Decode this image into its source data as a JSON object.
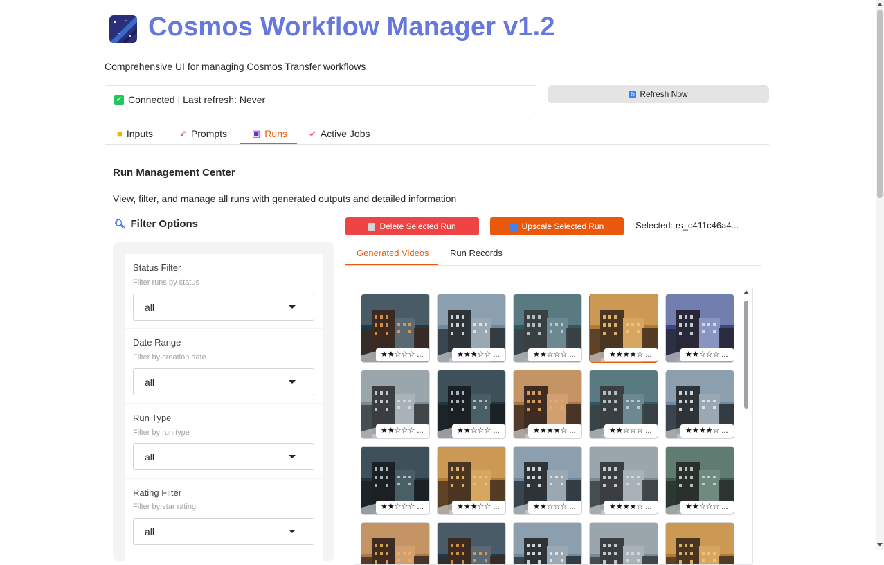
{
  "app": {
    "title": "Cosmos Workflow Manager v1.2",
    "subtitle": "Comprehensive UI for managing Cosmos Transfer workflows",
    "accent_color": "#6677dd"
  },
  "status": {
    "text": "Connected | Last refresh: Never",
    "icon": "check-icon",
    "refresh_label": "Refresh Now",
    "refresh_icon": "refresh-icon"
  },
  "tabs": [
    {
      "label": "Inputs",
      "icon": "folder-icon",
      "active": false
    },
    {
      "label": "Prompts",
      "icon": "rocket-icon",
      "active": false
    },
    {
      "label": "Runs",
      "icon": "clapper-icon",
      "active": true
    },
    {
      "label": "Active Jobs",
      "icon": "rocket-icon",
      "active": false
    }
  ],
  "runs": {
    "heading": "Run Management Center",
    "description": "View, filter, and manage all runs with generated outputs and detailed information",
    "filter_title": "Filter Options",
    "filters": [
      {
        "label": "Status Filter",
        "hint": "Filter runs by status",
        "value": "all"
      },
      {
        "label": "Date Range",
        "hint": "Filter by creation date",
        "value": "all"
      },
      {
        "label": "Run Type",
        "hint": "Filter by run type",
        "value": "all"
      },
      {
        "label": "Rating Filter",
        "hint": "Filter by star rating",
        "value": "all"
      }
    ],
    "delete_label": "Delete Selected Run",
    "upscale_label": "Upscale Selected Run",
    "selected_text": "Selected: rs_c411c46a4...",
    "subtabs": [
      {
        "label": "Generated Videos",
        "active": true
      },
      {
        "label": "Run Records",
        "active": false
      }
    ],
    "gallery": [
      {
        "caption": "★★☆☆☆ ...",
        "palette": "night",
        "selected": false
      },
      {
        "caption": "★★★☆☆ ...",
        "palette": "snow",
        "selected": false
      },
      {
        "caption": "★★☆☆☆ ...",
        "palette": "teal",
        "selected": false
      },
      {
        "caption": "★★★★☆ ...",
        "palette": "amber",
        "selected": true
      },
      {
        "caption": "★★☆☆☆ ...",
        "palette": "dusk",
        "selected": false
      },
      {
        "caption": "★★☆☆☆ ...",
        "palette": "grey",
        "selected": false
      },
      {
        "caption": "★★☆☆☆ ...",
        "palette": "storm",
        "selected": false
      },
      {
        "caption": "★★★★☆ ...",
        "palette": "sunset",
        "selected": false
      },
      {
        "caption": "★★☆☆☆ ...",
        "palette": "teal",
        "selected": false
      },
      {
        "caption": "★★★★☆ ...",
        "palette": "snow",
        "selected": false
      },
      {
        "caption": "★★☆☆☆ ...",
        "palette": "storm",
        "selected": false
      },
      {
        "caption": "★★★☆☆ ...",
        "palette": "amber",
        "selected": false
      },
      {
        "caption": "★★☆☆☆ ...",
        "palette": "snow",
        "selected": false
      },
      {
        "caption": "★★★★☆ ...",
        "palette": "grey",
        "selected": false
      },
      {
        "caption": "★★☆☆☆ ...",
        "palette": "forest",
        "selected": false
      },
      {
        "caption": "",
        "palette": "sunset",
        "selected": false
      },
      {
        "caption": "",
        "palette": "night",
        "selected": false
      },
      {
        "caption": "",
        "palette": "snow",
        "selected": false
      },
      {
        "caption": "",
        "palette": "grey",
        "selected": false
      },
      {
        "caption": "",
        "palette": "amber",
        "selected": false
      }
    ]
  }
}
